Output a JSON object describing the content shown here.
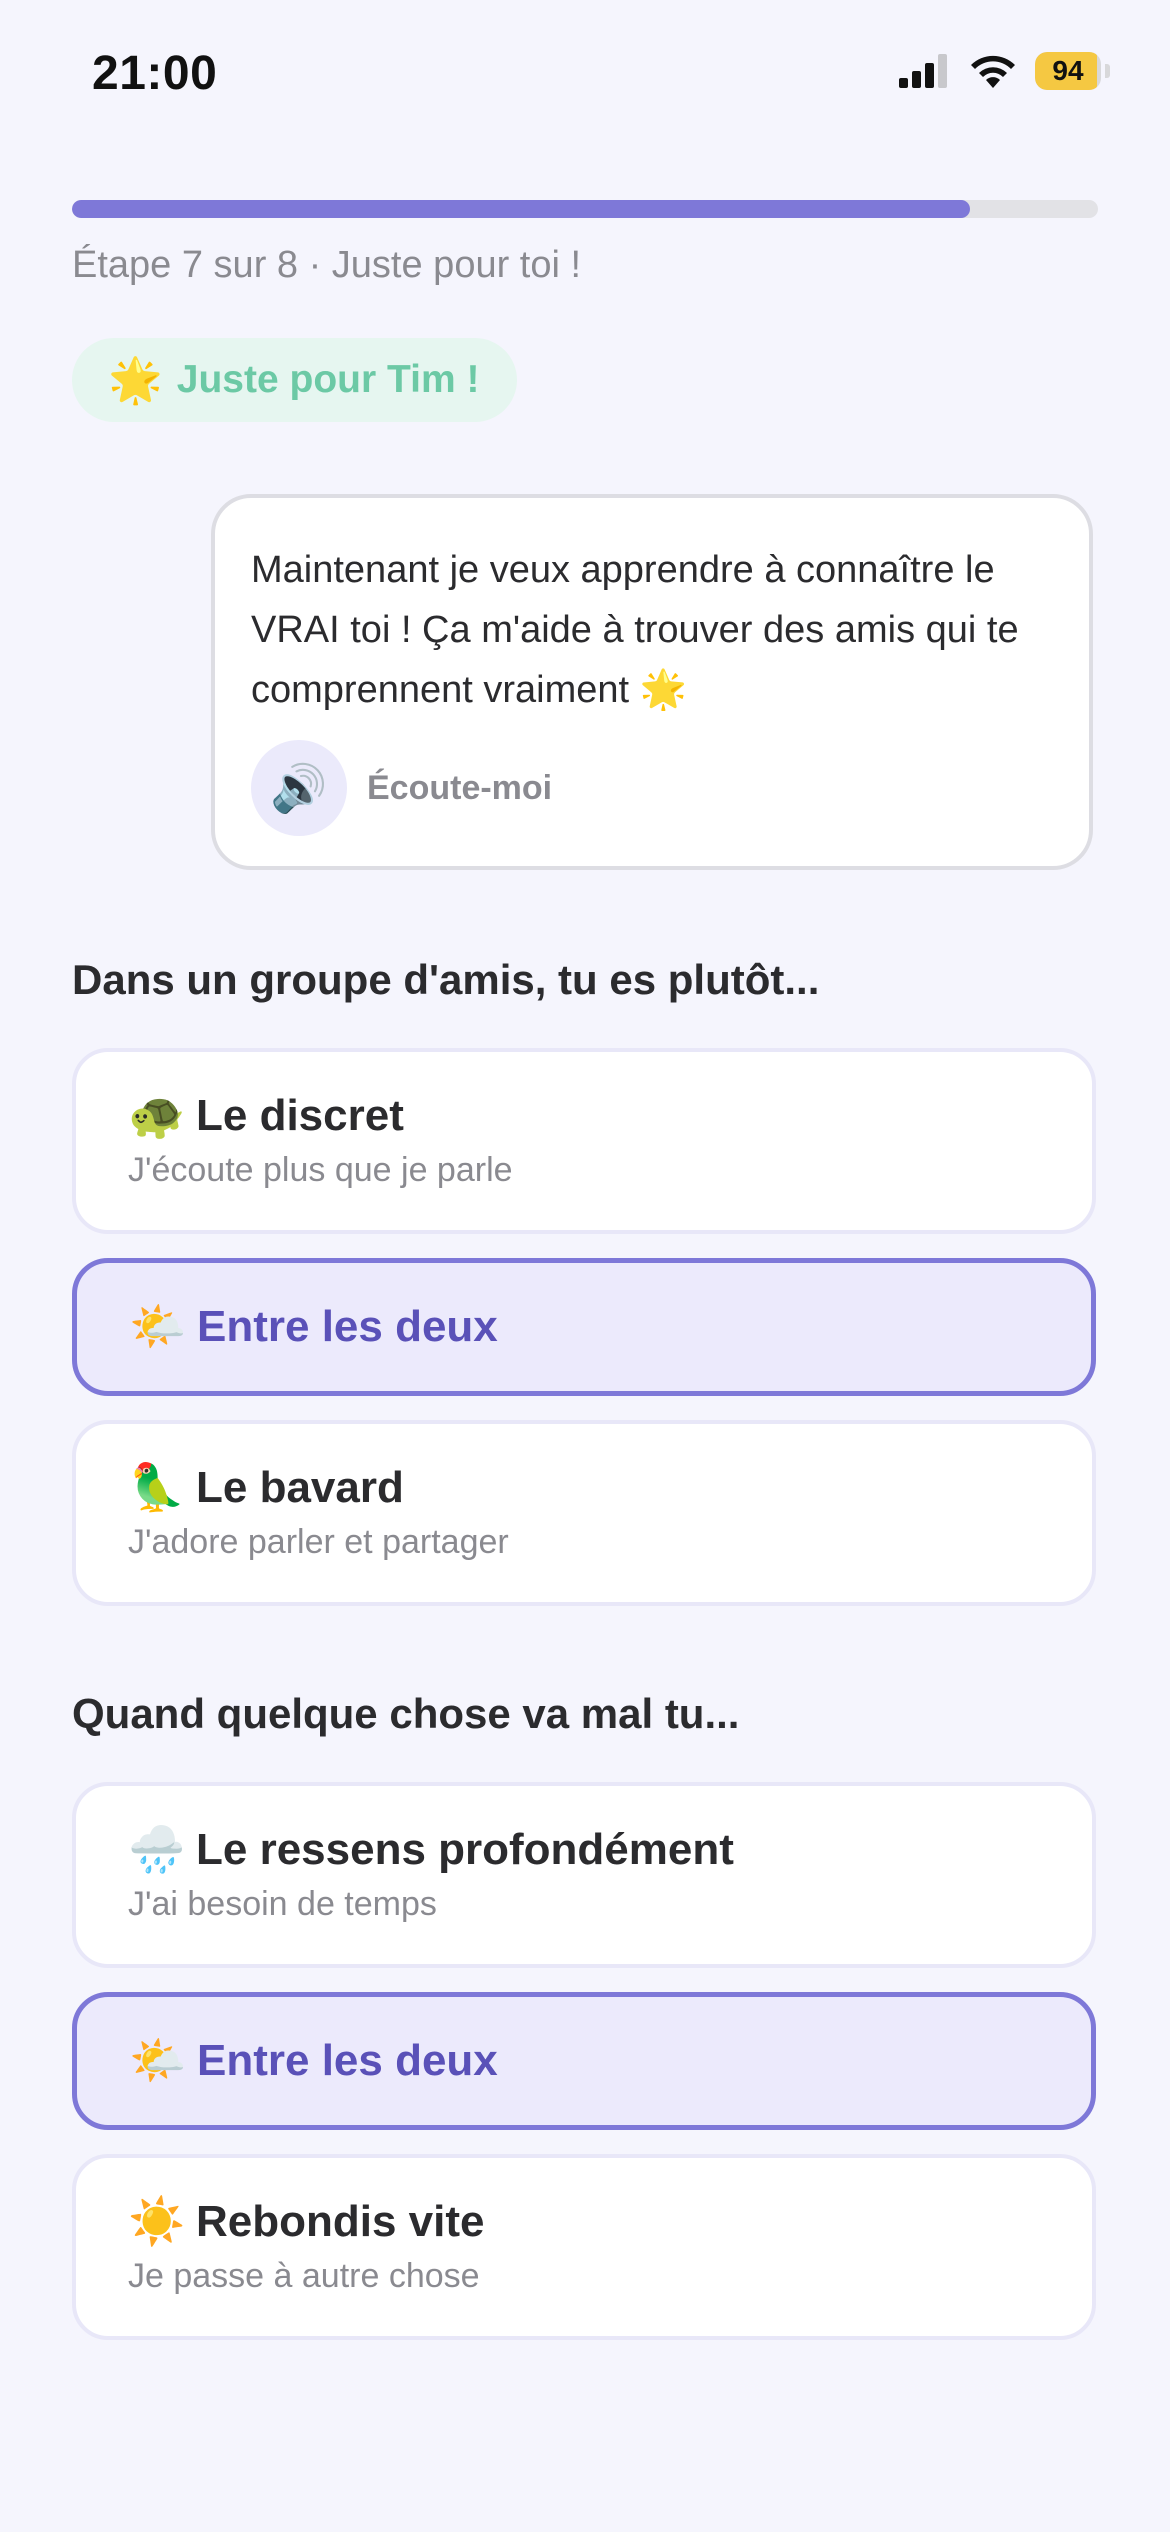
{
  "status_bar": {
    "time": "21:00",
    "battery_level": "94",
    "battery_fill_fraction": 0.94,
    "icons": [
      "cellular-signal-icon",
      "wifi-icon",
      "battery-charging-icon"
    ]
  },
  "progress": {
    "fraction": 0.875,
    "label": "Étape 7 sur 8 · Juste pour toi !"
  },
  "pill": {
    "emoji": "🌟",
    "text": "Juste pour Tim !"
  },
  "bubble": {
    "text": "Maintenant je veux apprendre à connaître le VRAI toi ! Ça m'aide à trouver des amis qui te comprennent vraiment 🌟",
    "listen_icon": "🔊",
    "listen_label": "Écoute-moi"
  },
  "questions": [
    {
      "title": "Dans un groupe d'amis, tu es plutôt...",
      "options": [
        {
          "emoji": "🐢",
          "title": "Le discret",
          "subtitle": "J'écoute plus que je parle",
          "selected": false
        },
        {
          "emoji": "🌤️",
          "title": "Entre les deux",
          "subtitle": "",
          "selected": true
        },
        {
          "emoji": "🦜",
          "title": "Le bavard",
          "subtitle": "J'adore parler et partager",
          "selected": false
        }
      ]
    },
    {
      "title": "Quand quelque chose va mal tu...",
      "options": [
        {
          "emoji": "🌧️",
          "title": "Le ressens profondément",
          "subtitle": "J'ai besoin de temps",
          "selected": false
        },
        {
          "emoji": "🌤️",
          "title": "Entre les deux",
          "subtitle": "",
          "selected": true
        },
        {
          "emoji": "☀️",
          "title": "Rebondis vite",
          "subtitle": "Je passe à autre chose",
          "selected": false
        }
      ]
    }
  ],
  "colors": {
    "background": "#f5f5fd",
    "accent": "#7e78d8",
    "accent_text": "#5a51b8",
    "pill_bg": "#e6f6f0",
    "pill_text": "#6cc9a5"
  }
}
